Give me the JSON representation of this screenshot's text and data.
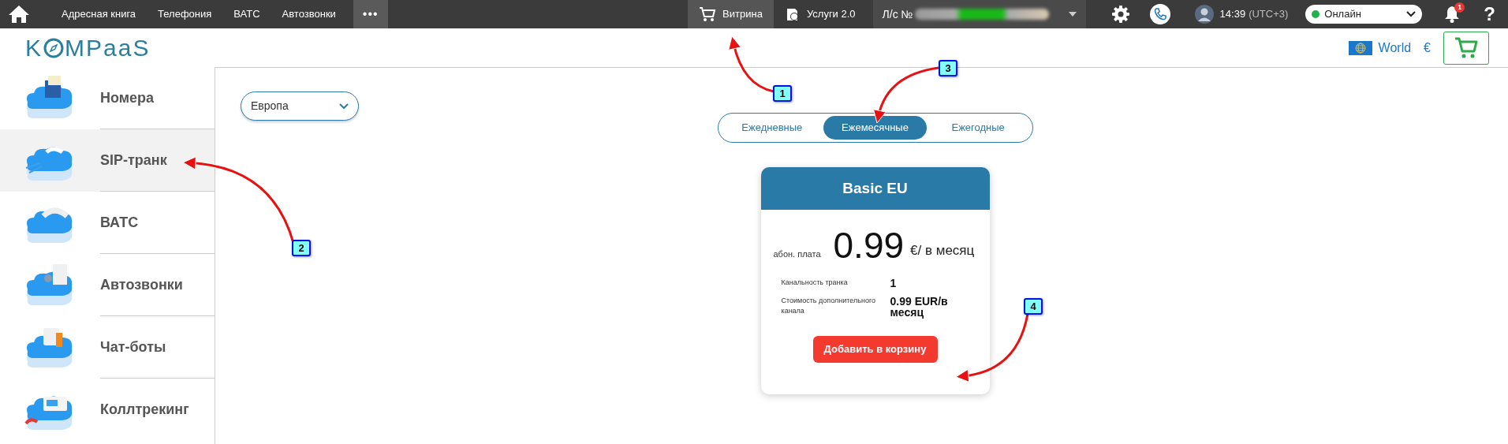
{
  "top_nav": {
    "menu": [
      {
        "label": "Адресная книга"
      },
      {
        "label": "Телефония"
      },
      {
        "label": "ВАТС"
      },
      {
        "label": "Автозвонки"
      }
    ],
    "more": "•••",
    "shop": [
      {
        "label": "Витрина",
        "selected": true
      },
      {
        "label": "Услуги 2.0",
        "selected": false
      }
    ],
    "account": "Л/с №",
    "time": "14:39",
    "timezone": "(UTC+3)",
    "status": {
      "label": "Онлайн",
      "online": true
    },
    "notifications": "1",
    "help": "?"
  },
  "header": {
    "logo": {
      "first": "K",
      "rest": "MPaaS"
    },
    "region": "World",
    "currency": "€"
  },
  "sidebar": {
    "items": [
      {
        "label": "Номера",
        "selected": false
      },
      {
        "label": "SIP-транк",
        "selected": true
      },
      {
        "label": "ВАТС",
        "selected": false
      },
      {
        "label": "Автозвонки",
        "selected": false
      },
      {
        "label": "Чат-боты",
        "selected": false
      },
      {
        "label": "Коллтрекинг",
        "selected": false
      }
    ]
  },
  "region_select": {
    "value": "Европа"
  },
  "periods": [
    {
      "label": "Ежедневные",
      "selected": false
    },
    {
      "label": "Ежемесячные",
      "selected": true
    },
    {
      "label": "Ежегодные",
      "selected": false
    }
  ],
  "plan": {
    "title": "Basic EU",
    "fee_label": "абон. плата",
    "price": "0.99",
    "unit": "€/ в месяц",
    "details": [
      {
        "label": "Канальность транка",
        "value": "1"
      },
      {
        "label": "Стоимость дополнительного канала",
        "value": "0.99 EUR/в месяц"
      }
    ],
    "button": "Добавить в корзину"
  },
  "annotations": [
    {
      "number": "1"
    },
    {
      "number": "2"
    },
    {
      "number": "3"
    },
    {
      "number": "4"
    }
  ]
}
